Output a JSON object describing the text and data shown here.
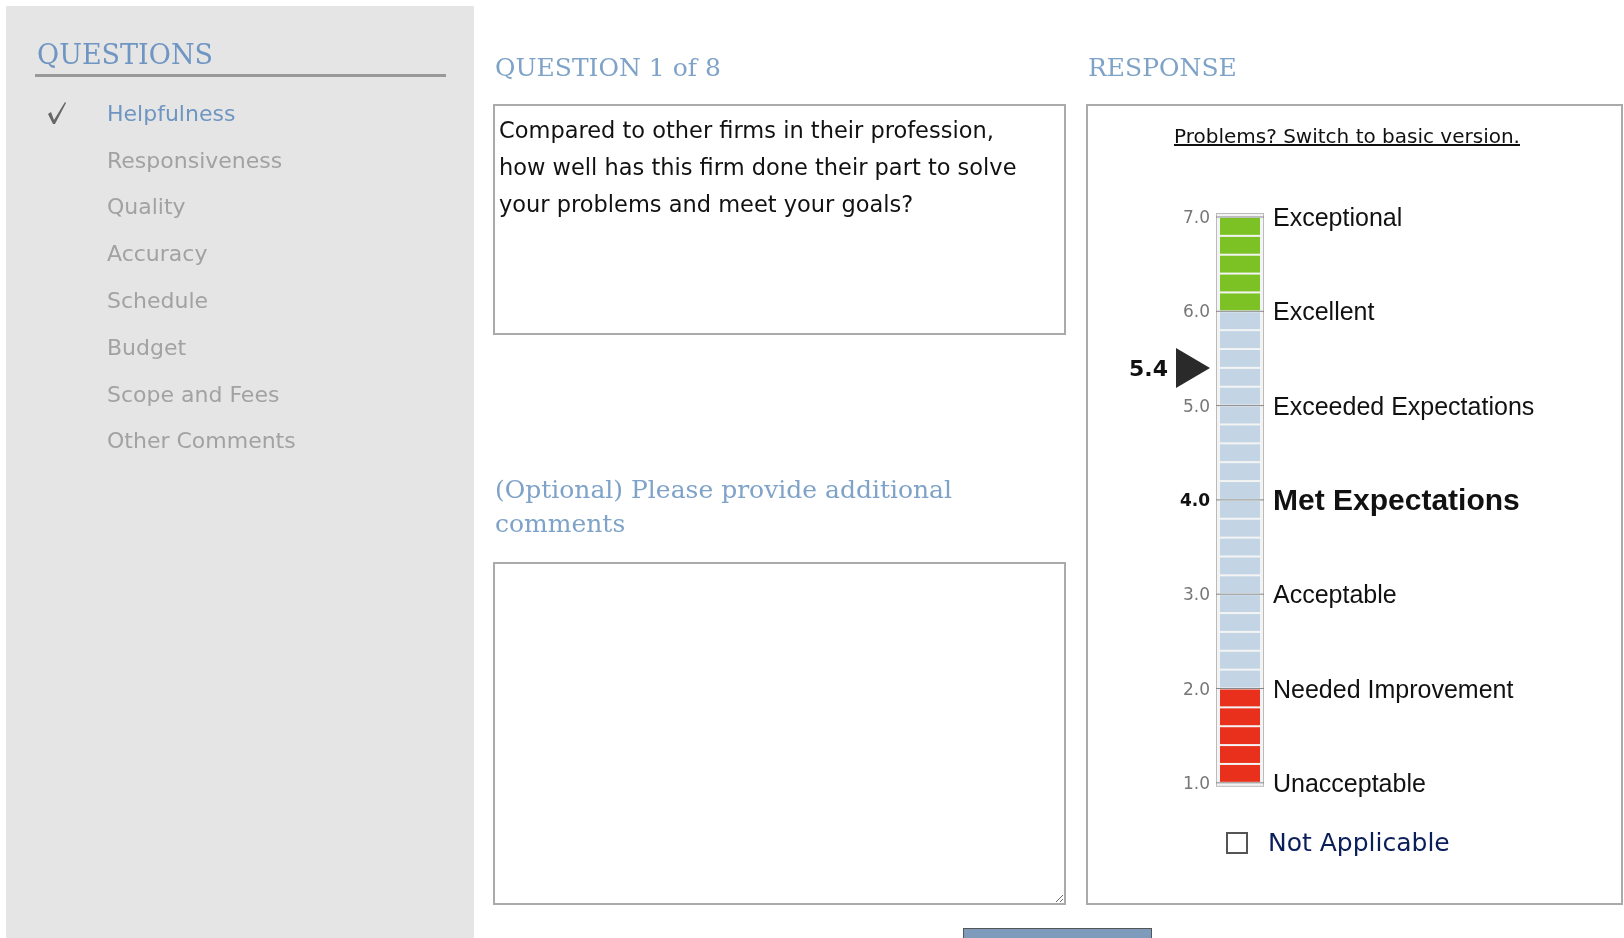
{
  "sidebar": {
    "title": "QUESTIONS",
    "items": [
      {
        "label": "Helpfulness",
        "checked": true,
        "selected": true
      },
      {
        "label": "Responsiveness",
        "checked": false,
        "selected": false
      },
      {
        "label": "Quality",
        "checked": false,
        "selected": false
      },
      {
        "label": "Accuracy",
        "checked": false,
        "selected": false
      },
      {
        "label": "Schedule",
        "checked": false,
        "selected": false
      },
      {
        "label": "Budget",
        "checked": false,
        "selected": false
      },
      {
        "label": "Scope and Fees",
        "checked": false,
        "selected": false
      },
      {
        "label": "Other Comments",
        "checked": false,
        "selected": false
      }
    ]
  },
  "question": {
    "heading": "QUESTION 1 of 8",
    "text": "Compared to other firms in their profession, how well has this firm done their part to solve your problems and meet your goals?"
  },
  "comments": {
    "label": "(Optional) Please provide additional comments"
  },
  "response": {
    "heading": "RESPONSE",
    "link": "Problems? Switch to basic version.",
    "scale": [
      {
        "tick": "7.0",
        "label": "Exceptional",
        "emphasized": false,
        "color": "#7cc224"
      },
      {
        "tick": "6.0",
        "label": "Excellent",
        "emphasized": false,
        "color": "#c3d5e4"
      },
      {
        "tick": "5.0",
        "label": "Exceeded Expectations",
        "emphasized": false,
        "color": "#c3d5e4"
      },
      {
        "tick": "4.0",
        "label": "Met Expectations",
        "emphasized": true,
        "color": "#c3d5e4"
      },
      {
        "tick": "3.0",
        "label": "Acceptable",
        "emphasized": false,
        "color": "#c3d5e4"
      },
      {
        "tick": "2.0",
        "label": "Needed Improvement",
        "emphasized": false,
        "color": "#e8301c"
      },
      {
        "tick": "1.0",
        "label": "Unacceptable",
        "emphasized": false
      }
    ],
    "pointer": {
      "reading": "5.4",
      "level": 0.7333
    },
    "not_applicable": {
      "label": "Not Applicable",
      "checked": false
    }
  }
}
